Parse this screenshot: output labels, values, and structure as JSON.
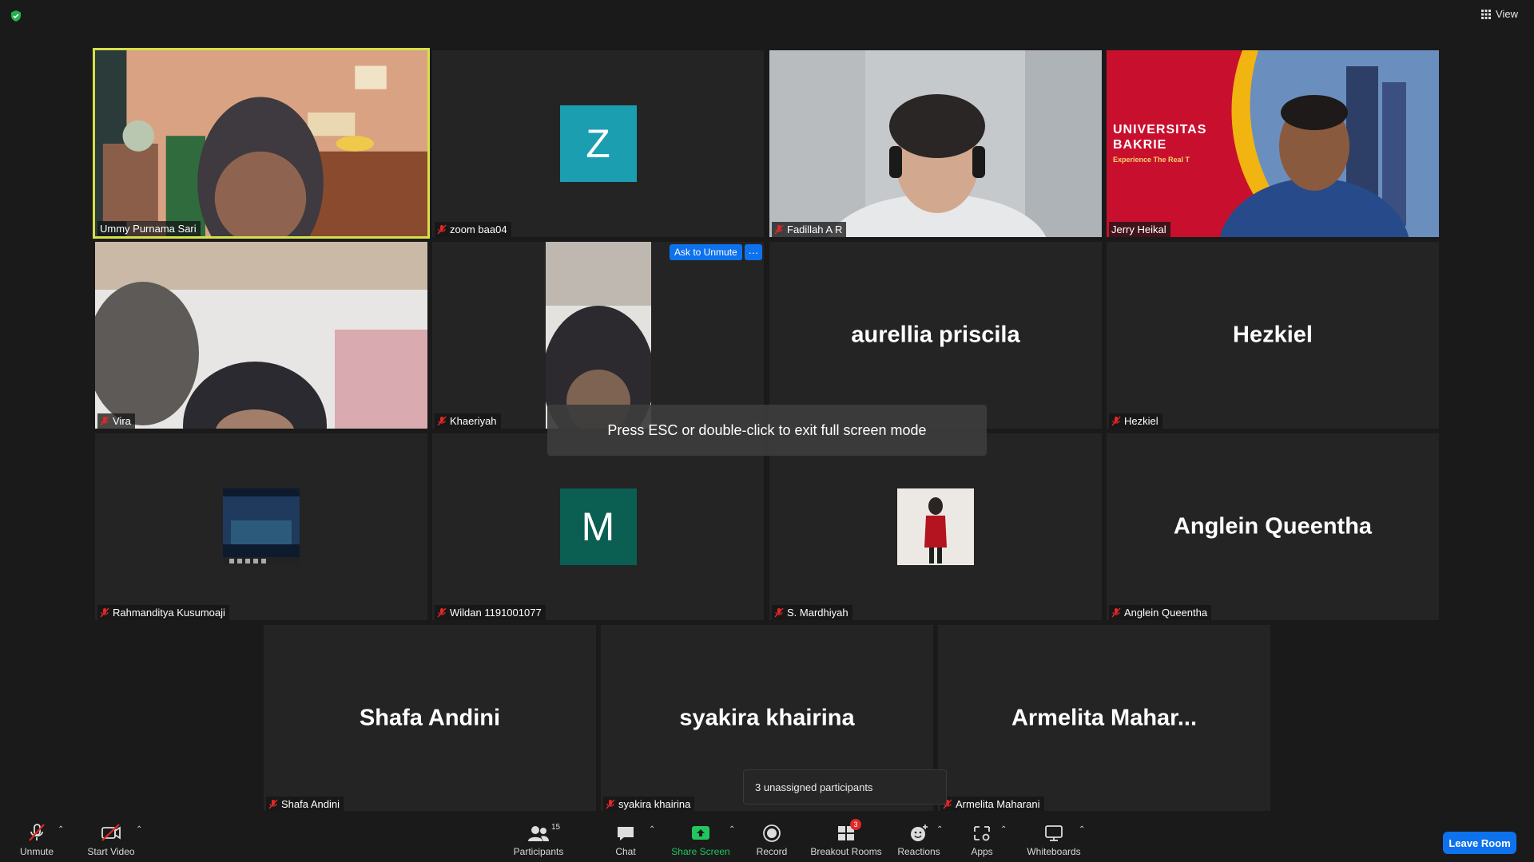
{
  "header": {
    "view_label": "View"
  },
  "tiles": [
    {
      "name": "Ummy Purnama Sari"
    },
    {
      "name": "zoom baa04",
      "letter": "Z",
      "color": "#1a9eb0"
    },
    {
      "name": "Fadillah A R"
    },
    {
      "name": "Jerry Heikal",
      "banner_line1": "UNIVERSITAS",
      "banner_line2": "BAKRIE",
      "banner_line3": "Experience The Real T"
    },
    {
      "name": "Vira"
    },
    {
      "name": "Khaeriyah"
    },
    {
      "name": "aurellia priscila",
      "display": "aurellia priscila"
    },
    {
      "name": "Hezkiel",
      "display": "Hezkiel"
    },
    {
      "name": "Rahmanditya Kusumoaji"
    },
    {
      "name": "Wildan 1191001077",
      "letter": "M",
      "color": "#0a5e52"
    },
    {
      "name": "S. Mardhiyah"
    },
    {
      "name": "Anglein Queentha",
      "display": "Anglein Queentha"
    },
    {
      "name": "Shafa Andini",
      "display": "Shafa Andini"
    },
    {
      "name": "syakira khairina",
      "display": "syakira khairina"
    },
    {
      "name": "Armelita Maharani",
      "display": "Armelita  Mahar..."
    }
  ],
  "overlay": {
    "ask_to_unmute": "Ask to Unmute",
    "more": "···",
    "fullscreen_toast": "Press ESC or double-click to exit full screen mode",
    "unassigned_tooltip": "3 unassigned participants"
  },
  "toolbar": {
    "unmute": "Unmute",
    "start_video": "Start Video",
    "participants": "Participants",
    "participants_count": "15",
    "chat": "Chat",
    "share_screen": "Share Screen",
    "record": "Record",
    "breakout_rooms": "Breakout Rooms",
    "breakout_badge": "3",
    "reactions": "Reactions",
    "apps": "Apps",
    "whiteboards": "Whiteboards",
    "leave_room": "Leave Room",
    "share_color": "#22c55e"
  }
}
